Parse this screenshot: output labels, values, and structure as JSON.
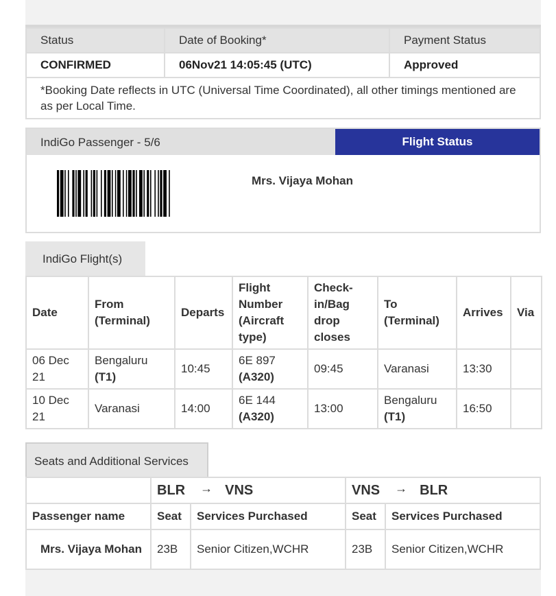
{
  "booking": {
    "headers": [
      "Status",
      "Date of Booking*",
      "Payment Status"
    ],
    "status": "CONFIRMED",
    "date": "06Nov21 14:05:45 (UTC)",
    "payment": "Approved",
    "note": "*Booking Date reflects in UTC (Universal Time Coordinated), all other timings mentioned are as per Local Time."
  },
  "passenger": {
    "title": "IndiGo Passenger - 5/6",
    "flight_status_label": "Flight Status",
    "name": "Mrs. Vijaya Mohan"
  },
  "flights": {
    "tab_label": "IndiGo Flight(s)",
    "headers": [
      "Date",
      "From (Terminal)",
      "Departs",
      "Flight Number (Aircraft type)",
      "Check-in/Bag drop closes",
      "To (Terminal)",
      "Arrives",
      "Via"
    ],
    "rows": [
      {
        "date": "06 Dec 21",
        "from": "Bengaluru",
        "from_terminal": "(T1)",
        "departs": "10:45",
        "flight": "6E 897",
        "aircraft": "(A320)",
        "checkin": "09:45",
        "to": "Varanasi",
        "to_terminal": "",
        "arrives": "13:30",
        "via": ""
      },
      {
        "date": "10 Dec 21",
        "from": "Varanasi",
        "from_terminal": "",
        "departs": "14:00",
        "flight": "6E 144",
        "aircraft": "(A320)",
        "checkin": "13:00",
        "to": "Bengaluru",
        "to_terminal": "(T1)",
        "arrives": "16:50",
        "via": ""
      }
    ]
  },
  "seats": {
    "tab_label": "Seats and Additional Services",
    "arrow": "→",
    "segments": [
      {
        "from": "BLR",
        "to": "VNS"
      },
      {
        "from": "VNS",
        "to": "BLR"
      }
    ],
    "col_passenger": "Passenger name",
    "col_seat": "Seat",
    "col_services": "Services Purchased",
    "rows": [
      {
        "name": "Mrs. Vijaya Mohan",
        "seat1": "23B",
        "services1": "Senior Citizen,WCHR",
        "seat2": "23B",
        "services2": "Senior Citizen,WCHR"
      }
    ]
  }
}
